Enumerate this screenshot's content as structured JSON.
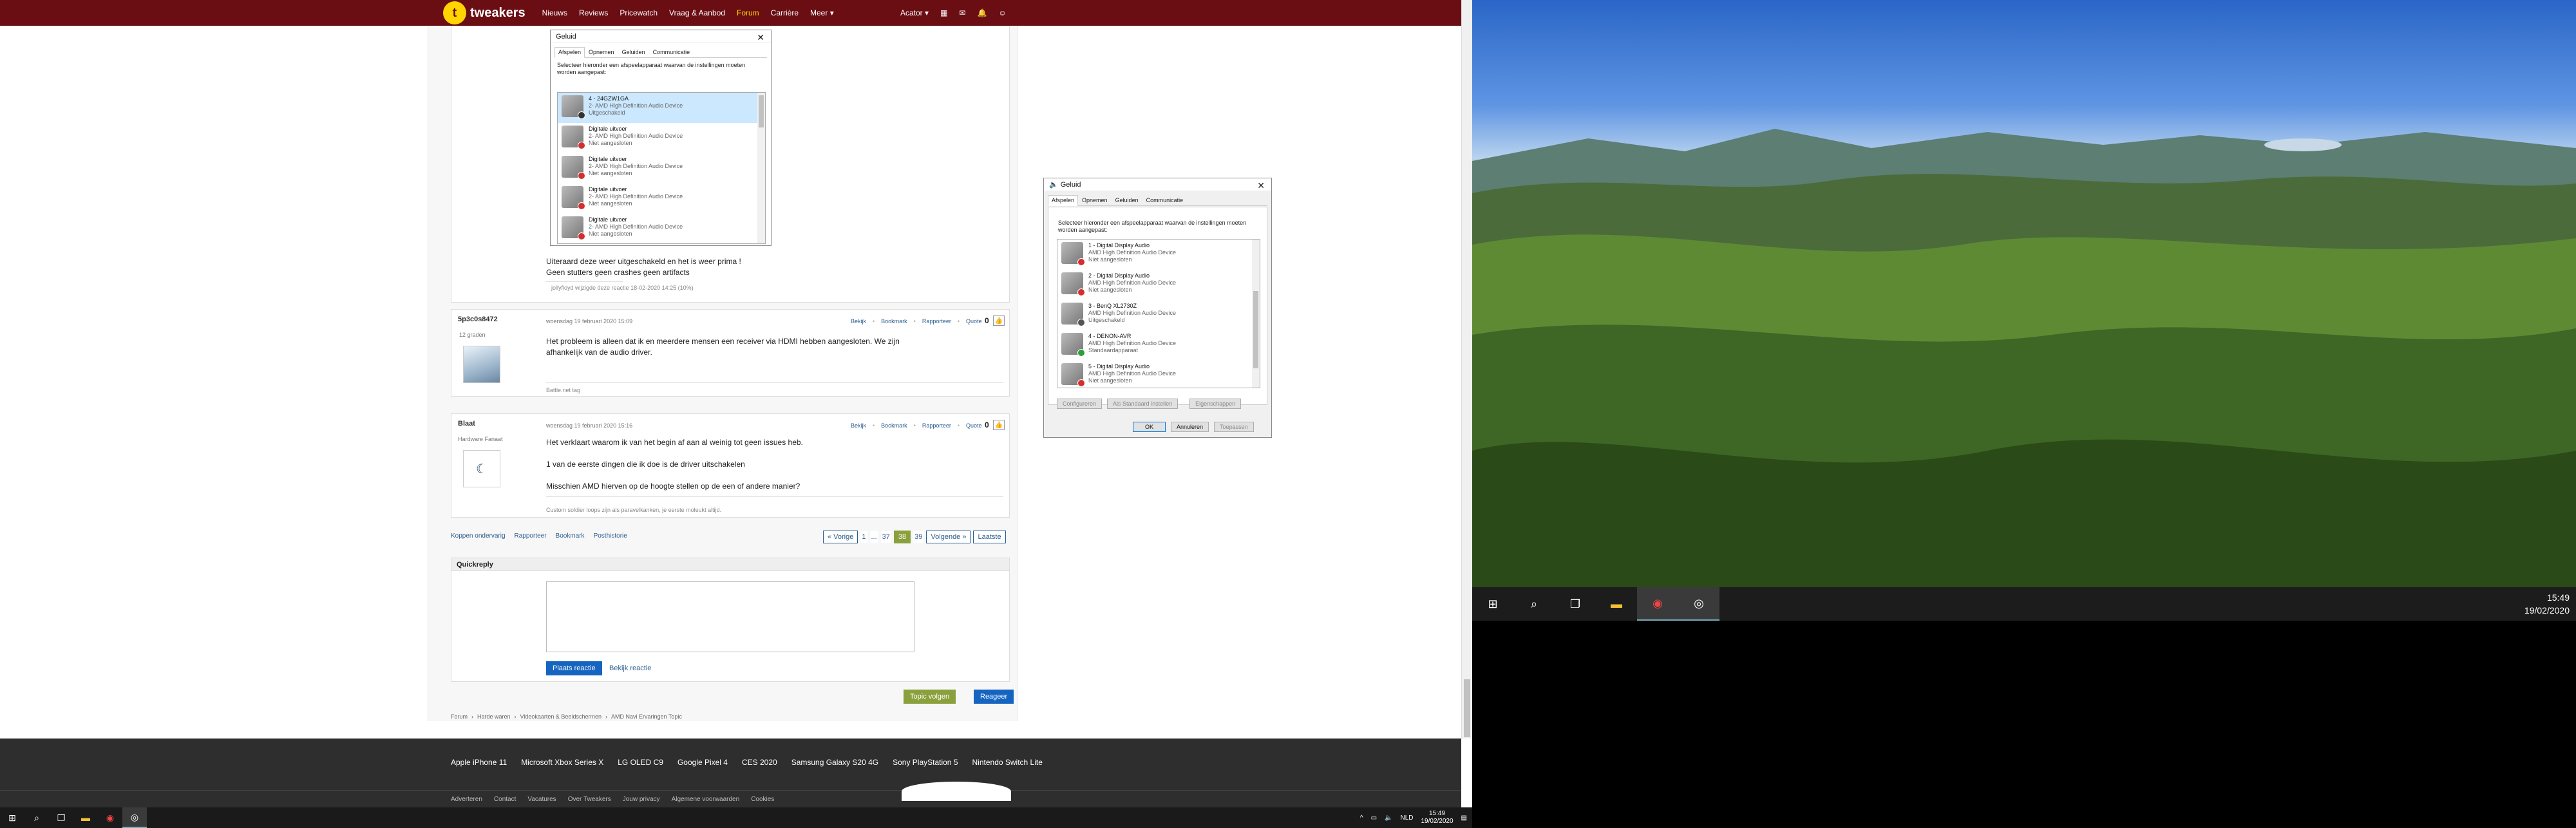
{
  "header": {
    "logo": "t",
    "site_name": "tweakers",
    "nav": [
      "Nieuws",
      "Reviews",
      "Pricewatch",
      "Vraag & Aanbod",
      "Forum",
      "Carrière",
      "Meer ▾"
    ],
    "user": "Acator ▾"
  },
  "post1": {
    "dialog": {
      "title": "Geluid",
      "tabs": [
        "Afspelen",
        "Opnemen",
        "Geluiden",
        "Communicatie"
      ],
      "desc": "Selecteer hieronder een afspeelapparaat waarvan de instellingen moeten worden aangepast:",
      "items": [
        {
          "name": "4 - 24GZW1GA",
          "sub1": "2- AMD High Definition Audio Device",
          "sub2": "Uitgeschakeld"
        },
        {
          "name": "Digitale uitvoer",
          "sub1": "2- AMD High Definition Audio Device",
          "sub2": "Niet aangesloten"
        },
        {
          "name": "Digitale uitvoer",
          "sub1": "2- AMD High Definition Audio Device",
          "sub2": "Niet aangesloten"
        },
        {
          "name": "Digitale uitvoer",
          "sub1": "2- AMD High Definition Audio Device",
          "sub2": "Niet aangesloten"
        },
        {
          "name": "Digitale uitvoer",
          "sub1": "2- AMD High Definition Audio Device",
          "sub2": "Niet aangesloten"
        }
      ]
    },
    "text1": "Uiteraard deze weer uitgeschakeld en het is weer prima !",
    "text2": "Geen stutters geen crashes geen artifacts",
    "edit_note": "jollyfloyd wijzigde deze reactie 18-02-2020 14:25 (10%)"
  },
  "post2": {
    "author": "5p3c0s8472",
    "rank": "12 graden",
    "date": "woensdag 19 februari 2020 15:09",
    "actions": [
      "Bekijk",
      "Bookmark",
      "Rapporteer",
      "Quote"
    ],
    "score": "0",
    "text1": "Het probleem is alleen dat ik en meerdere mensen een receiver via HDMI hebben aangesloten. We zijn",
    "text2": "afhankelijk van de audio driver.",
    "signature": "Battle.net tag"
  },
  "post3": {
    "author": "Blaat",
    "rank": "Hardware Fanaat",
    "date": "woensdag 19 februari 2020 15:16",
    "actions": [
      "Bekijk",
      "Bookmark",
      "Rapporteer",
      "Quote"
    ],
    "score": "0",
    "text1": "Het verklaart waarom ik van het begin af aan al weinig tot geen issues heb.",
    "text2": "1 van de eerste dingen die ik doe is de driver uitschakelen",
    "text3": "Misschien AMD hierven op de hoogte stellen op de een of andere manier?",
    "signature": "Custom soldier loops zijn als paravelkanken, je eerste moleukt altijd."
  },
  "bottom_actions": [
    "Koppen ondervarig",
    "Rapporteer",
    "Bookmark",
    "Posthistorie"
  ],
  "pager": {
    "prev": "« Vorige",
    "pages": [
      "1",
      "...",
      "37",
      "38",
      "39"
    ],
    "current": "38",
    "next": "Volgende »",
    "last": "Laatste"
  },
  "quickreply": {
    "title": "Quickreply",
    "post_btn": "Plaats reactie",
    "preview": "Bekijk reactie"
  },
  "topic_buttons": {
    "follow": "Topic volgen",
    "reply": "Reageer"
  },
  "breadcrumb": [
    "Forum",
    "Harde waren",
    "Videokaarten & Beeldschermen",
    "AMD Navi Ervaringen Topic"
  ],
  "footer": {
    "links": [
      "Apple iPhone 11",
      "Microsoft Xbox Series X",
      "LG OLED C9",
      "Google Pixel 4",
      "CES 2020",
      "Samsung Galaxy S20 4G",
      "Sony PlayStation 5",
      "Nintendo Switch Lite"
    ],
    "small": [
      "Adverteren",
      "Contact",
      "Vacatures",
      "Over Tweakers",
      "Jouw privacy",
      "Algemene voorwaarden",
      "Cookies"
    ]
  },
  "dialog2": {
    "title": "Geluid",
    "tabs": [
      "Afspelen",
      "Opnemen",
      "Geluiden",
      "Communicatie"
    ],
    "desc": "Selecteer hieronder een afspeelapparaat waarvan de instellingen moeten worden aangepast:",
    "items": [
      {
        "name": "1 - Digital Display Audio",
        "sub1": "AMD High Definition Audio Device",
        "sub2": "Niet aangesloten"
      },
      {
        "name": "2 - Digital Display Audio",
        "sub1": "AMD High Definition Audio Device",
        "sub2": "Niet aangesloten"
      },
      {
        "name": "3 - BenQ XL2730Z",
        "sub1": "AMD High Definition Audio Device",
        "sub2": "Uitgeschakeld"
      },
      {
        "name": "4 - DENON-AVR",
        "sub1": "AMD High Definition Audio Device",
        "sub2": "Standaardapparaat"
      },
      {
        "name": "5 - Digital Display Audio",
        "sub1": "AMD High Definition Audio Device",
        "sub2": "Niet aangesloten"
      }
    ],
    "btn_configure": "Configureren",
    "btn_default": "Als Standaard instellen",
    "btn_props": "Eigenschappen",
    "btn_ok": "OK",
    "btn_cancel": "Annuleren",
    "btn_apply": "Toepassen"
  },
  "taskbar1": {
    "tray_lang": "NLD",
    "time": "15:49",
    "date": "19/02/2020"
  },
  "taskbar2": {
    "time": "15:49",
    "date": "19/02/2020"
  },
  "colors": {
    "tweakers_red": "#6a0e14",
    "accent_yellow": "#ffd400",
    "link_blue": "#2a5d8f",
    "green": "#8aa03c"
  }
}
